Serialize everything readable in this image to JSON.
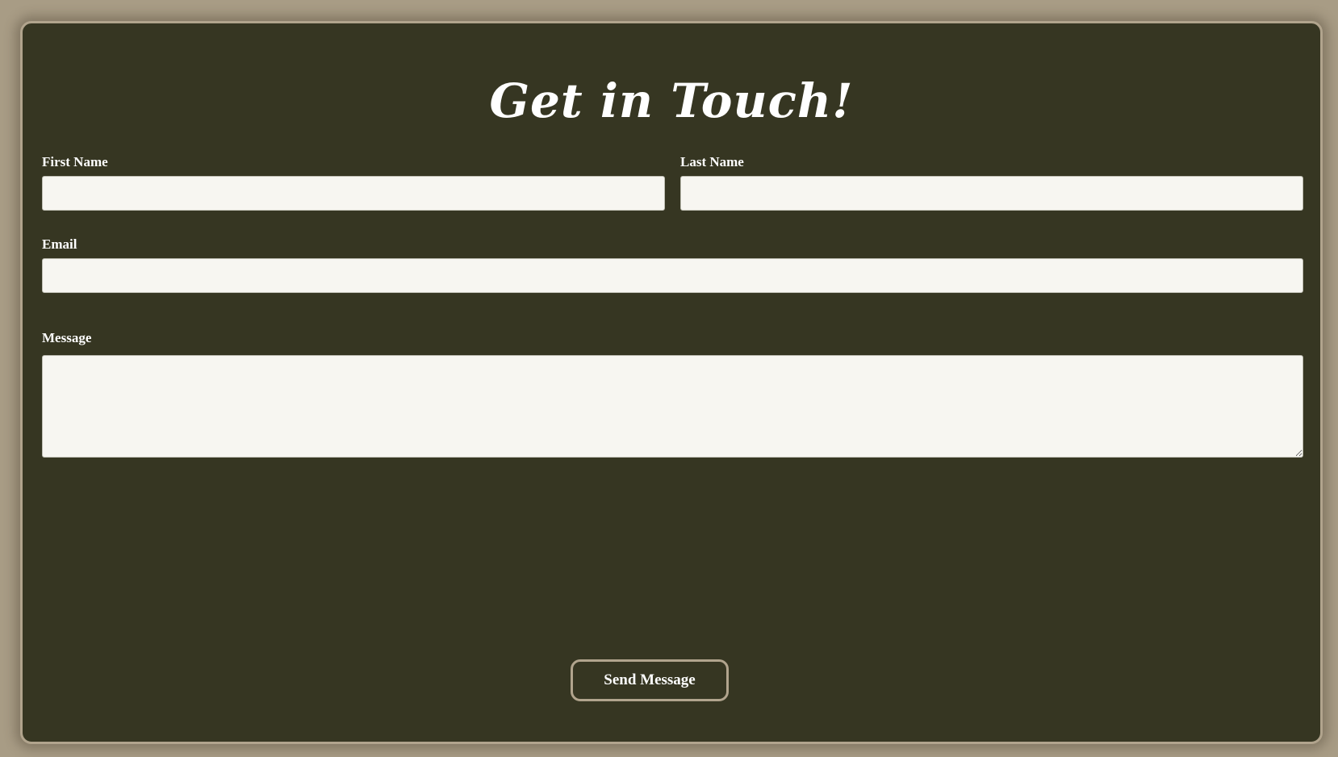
{
  "form": {
    "title": "Get in Touch!",
    "first_name": {
      "label": "First Name",
      "value": "",
      "placeholder": ""
    },
    "last_name": {
      "label": "Last Name",
      "value": "",
      "placeholder": ""
    },
    "email": {
      "label": "Email",
      "value": "",
      "placeholder": ""
    },
    "message": {
      "label": "Message",
      "value": "",
      "placeholder": ""
    },
    "submit_label": "Send Message"
  },
  "colors": {
    "page_background": "#a89c85",
    "card_background": "#363622",
    "card_border": "#b1a48d",
    "field_background": "#f7f6f1",
    "text": "#ffffff"
  }
}
